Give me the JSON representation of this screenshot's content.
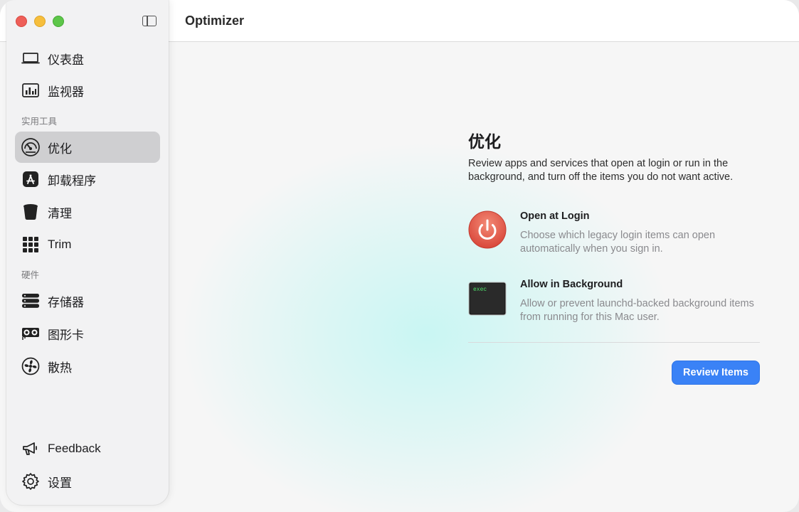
{
  "app": {
    "title": "Optimizer"
  },
  "sidebar": {
    "items_top": [
      {
        "label": "仪表盘",
        "icon": "laptop-icon"
      },
      {
        "label": "监视器",
        "icon": "bar-chart-icon"
      }
    ],
    "section_tools": "实用工具",
    "items_tools": [
      {
        "label": "优化",
        "icon": "speedometer-icon",
        "active": true
      },
      {
        "label": "卸载程序",
        "icon": "app-store-icon"
      },
      {
        "label": "清理",
        "icon": "trash-bin-icon"
      },
      {
        "label": "Trim",
        "icon": "grid-icon"
      }
    ],
    "section_hardware": "硬件",
    "items_hardware": [
      {
        "label": "存储器",
        "icon": "server-stack-icon"
      },
      {
        "label": "图形卡",
        "icon": "graphics-card-icon"
      },
      {
        "label": "散热",
        "icon": "fan-icon"
      }
    ],
    "items_bottom": [
      {
        "label": "Feedback",
        "icon": "megaphone-icon"
      },
      {
        "label": "设置",
        "icon": "gear-icon"
      }
    ]
  },
  "main": {
    "heading": "优化",
    "description": "Review apps and services that open at login or run in the background, and turn off the items you do not want active.",
    "features": [
      {
        "title": "Open at Login",
        "description": "Choose which legacy login items can open automatically when you sign in.",
        "icon": "power-icon"
      },
      {
        "title": "Allow in Background",
        "description": "Allow or prevent launchd-backed background items from running for this Mac user.",
        "icon": "terminal-exec-icon",
        "icon_text": "exec"
      }
    ],
    "review_button": "Review Items"
  },
  "colors": {
    "accent": "#3a82f6",
    "power_icon": "#e4594a",
    "active_item_bg": "#cfcfd1"
  }
}
